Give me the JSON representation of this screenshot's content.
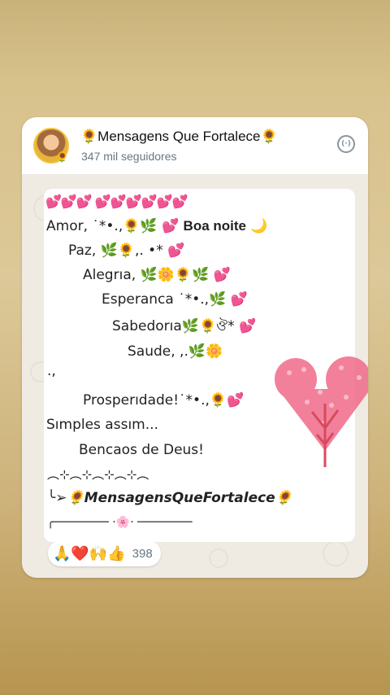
{
  "channel": {
    "name": "🌻Mensagens Que Fortalece🌻",
    "followers": "347 mil seguidores"
  },
  "message": {
    "hearts_row": "💕💕💕 💕💕💕💕💕💕",
    "line1": "Amor,      ˙*•.,🌻🌿      💕",
    "line1_bold": "Boa noite",
    "line1_moon": "🌙",
    "line2": "Paz,                  🌿🌻,. •*   💕",
    "line3": "Alegrıa,     🌿🌼🌻🌿      💕",
    "line4": "Esperanca   ˙*•.,🌿    💕",
    "line5": "Sabedorıa🌿🌻ঔ*   💕",
    "line6": "Saude, ,.🌿🌼",
    "line7": ".,",
    "line8": "Prosperıdade!˙*•.,🌻💕",
    "line9": "Sımples assım...",
    "line10": "Bencaos de Deus!",
    "divider1": "︵⊹︵⊹︵⊹︵⊹︵",
    "signature": "╰➢🌻MensagensQueFortalece🌻",
    "divider2": "╭──────── ·🌸· ────────"
  },
  "reactions": {
    "emojis": "🙏❤️🙌👍",
    "count": "398"
  },
  "colors": {
    "background_gold": "#d8c28c",
    "card_bg": "#efeae2",
    "bubble_bg": "#ffffff",
    "heart_pink": "#f06a8a"
  }
}
